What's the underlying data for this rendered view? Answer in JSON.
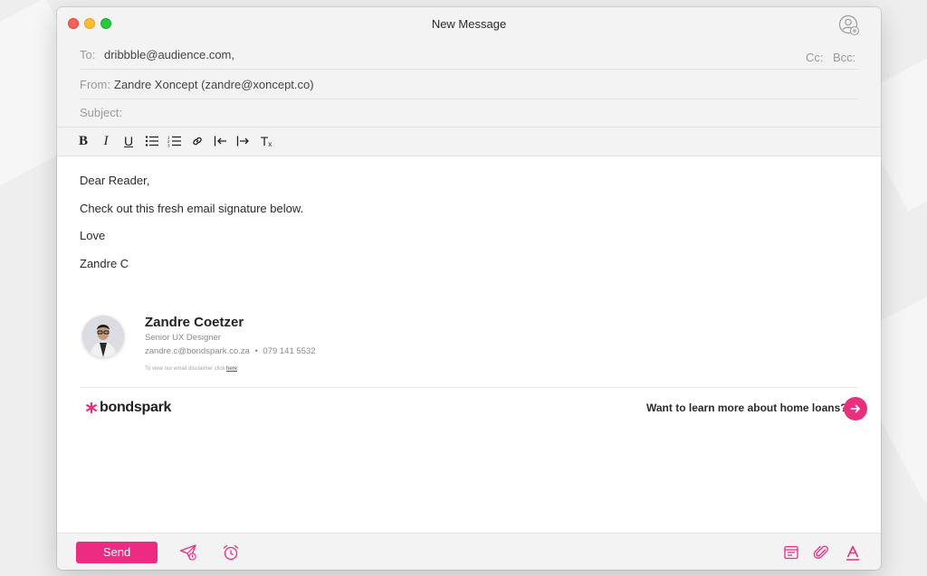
{
  "window": {
    "title": "New Message"
  },
  "header": {
    "to_label": "To:",
    "to_value": "dribbble@audience.com,",
    "cc_label": "Cc:",
    "bcc_label": "Bcc:",
    "from_label": "From:",
    "from_value": "Zandre Xoncept (zandre@xoncept.co)",
    "subject_label": "Subject:",
    "subject_value": ""
  },
  "toolbar": {
    "bold": "B",
    "italic": "I",
    "underline": "U",
    "clear_format": "T"
  },
  "body": {
    "lines": [
      "Dear Reader,",
      "Check out this fresh email signature below.",
      "Love",
      "Zandre C"
    ]
  },
  "signature": {
    "name": "Zandre Coetzer",
    "role": "Senior UX Designer",
    "email": "zandre.c@bondspark.co.za",
    "separator": "•",
    "phone": "079 141 5532",
    "disclaimer_text": "To view our email disclaimer click",
    "disclaimer_link": "here",
    "brand": "bondspark",
    "cta_text": "Want to learn more about home loans?"
  },
  "footer": {
    "send_label": "Send"
  },
  "colors": {
    "accent": "#ec2b82",
    "cta": "#ea2f7f",
    "chrome": "#f3f3f3"
  },
  "icons": {
    "contact": "add-contact-icon",
    "send_later": "send-later-icon",
    "alarm": "alarm-clock-icon",
    "template": "template-icon",
    "attachment": "paperclip-icon",
    "font": "font-style-icon"
  }
}
